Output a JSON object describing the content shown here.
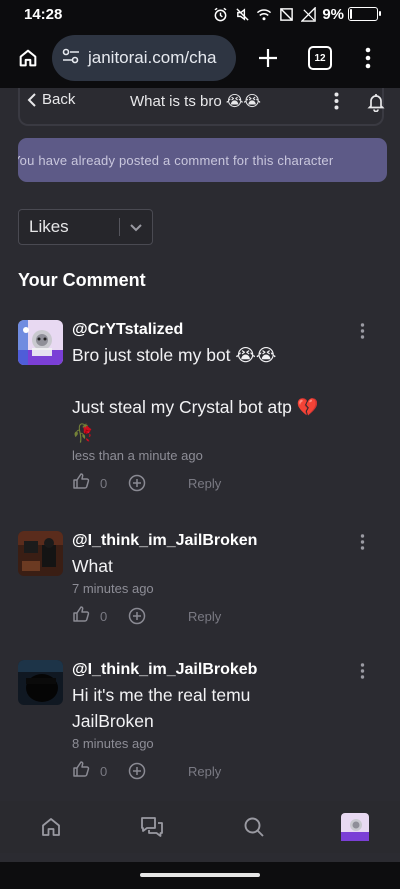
{
  "status_bar": {
    "time": "14:28",
    "battery_percent": "9%",
    "battery_level": 0.09
  },
  "browser": {
    "url": "janitorai.com/cha",
    "tab_count": "12"
  },
  "header": {
    "back_label": "Back",
    "title": "What is ts bro 😭😭"
  },
  "notice": {
    "text": "You have already posted a comment for this character"
  },
  "sort": {
    "selected": "Likes"
  },
  "section_title": "Your Comment",
  "comments": [
    {
      "username": "@CrYTstalized",
      "text_line1": "Bro just stole my bot 😭😭",
      "text_line2": "Just steal my Crystal bot atp 💔🥀",
      "time": "less than a minute ago",
      "likes": "0",
      "reply_label": "Reply"
    },
    {
      "username": "@I_think_im_JailBroken",
      "text_line1": "What",
      "time": "7 minutes ago",
      "likes": "0",
      "reply_label": "Reply"
    },
    {
      "username": "@I_think_im_JailBrokeb",
      "text_line1": "Hi it's me the real temu JailBroken",
      "time": "8 minutes ago",
      "likes": "0",
      "reply_label": "Reply"
    }
  ],
  "bottom_nav": [
    "home-icon",
    "chat-icon",
    "search-icon",
    "profile-avatar"
  ]
}
